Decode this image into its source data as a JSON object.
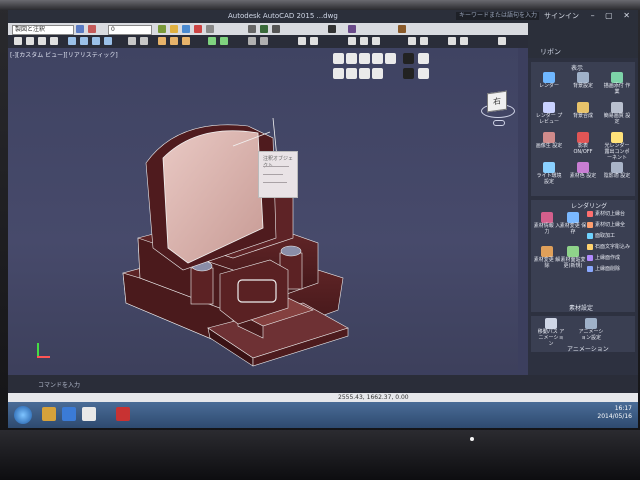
{
  "window": {
    "title": "Autodesk AutoCAD 2015   ...dwg",
    "search_placeholder": "キーワードまたは語句を入力",
    "signin_label": "サインイン",
    "window_controls": "– ▢ ✕"
  },
  "toolbar": {
    "workspace_value": "製図と注釈",
    "layer_value": "0"
  },
  "viewport": {
    "label": "[-][カスタム ビュー][リアリスティック]",
    "viewcube_face": "右",
    "popup_title": "注釈オブジェクト"
  },
  "ribbon": {
    "tab_label": "リボン"
  },
  "palette": {
    "section_display": "表示",
    "section_rendering": "レンダリング",
    "section_material": "素材設定",
    "section_animation": "アニメーション",
    "buttons_display": [
      {
        "label": "レンダー",
        "icon": "render-icon",
        "color": "#6fb7ff"
      },
      {
        "label": "背景設定",
        "icon": "background-icon",
        "color": "#9fb1c9"
      },
      {
        "label": "描画添付 作業",
        "icon": "attach-icon",
        "color": "#7dd3a8"
      },
      {
        "label": "レンダー プレビュー",
        "icon": "preview-icon",
        "color": "#c9d2ff"
      },
      {
        "label": "背景合成",
        "icon": "composite-icon",
        "color": "#e8c36a"
      },
      {
        "label": "簡易画質 設定",
        "icon": "quality-icon",
        "color": "#b9c0cf"
      },
      {
        "label": "画像生 設定",
        "icon": "image-icon",
        "color": "#d08b8b"
      },
      {
        "label": "影表 ON/OFF",
        "icon": "shadow-icon",
        "color": "#e05555"
      },
      {
        "label": "光レンダー 露出コンポーネント",
        "icon": "light-icon",
        "color": "#ffe27a"
      },
      {
        "label": "ライト環境 設定",
        "icon": "environment-icon",
        "color": "#8ad0ff"
      },
      {
        "label": "素材色 設定",
        "icon": "material-color-icon",
        "color": "#c87dd3"
      },
      {
        "label": "陰影適 設定",
        "icon": "shading-icon",
        "color": "#a9b4c8"
      }
    ],
    "render_left": [
      {
        "label": "素材情報 入力",
        "icon": "material-info-icon",
        "color": "#d35f8c"
      },
      {
        "label": "素材変更 保存",
        "icon": "material-save-icon",
        "color": "#7ab8ff"
      },
      {
        "label": "素材変更 解除",
        "icon": "material-reset-icon",
        "color": "#e0a05a"
      },
      {
        "label": "素材面貼変更(新規)",
        "icon": "material-new-icon",
        "color": "#8fd38a"
      }
    ],
    "render_right": [
      {
        "label": "素材切上縁台",
        "icon": "edge-icon",
        "color": "#ff6f6f"
      },
      {
        "label": "素材切上縁全",
        "icon": "edge-all-icon",
        "color": "#ff9f6f"
      },
      {
        "label": "面取加工",
        "icon": "chamfer-icon",
        "color": "#6fd3ff"
      },
      {
        "label": "石面文字彫込み",
        "icon": "engrave-icon",
        "color": "#ffd36f"
      },
      {
        "label": "上縁面作成",
        "icon": "top-face-icon",
        "color": "#b18aff"
      },
      {
        "label": "上縁面削除",
        "icon": "delete-face-icon",
        "color": "#8aa8ff"
      }
    ],
    "animation_buttons": [
      {
        "label": "移動パス アニメーション",
        "icon": "path-icon",
        "color": "#cfd6e6"
      },
      {
        "label": "アニメーション設定",
        "icon": "anim-settings-icon",
        "color": "#9fb1c9"
      }
    ]
  },
  "status": {
    "coords": "2555.43, 1662.37, 0.00",
    "cmd_hint": "コマンドを入力"
  },
  "taskbar": {
    "time": "16:17",
    "date": "2014/05/16"
  }
}
